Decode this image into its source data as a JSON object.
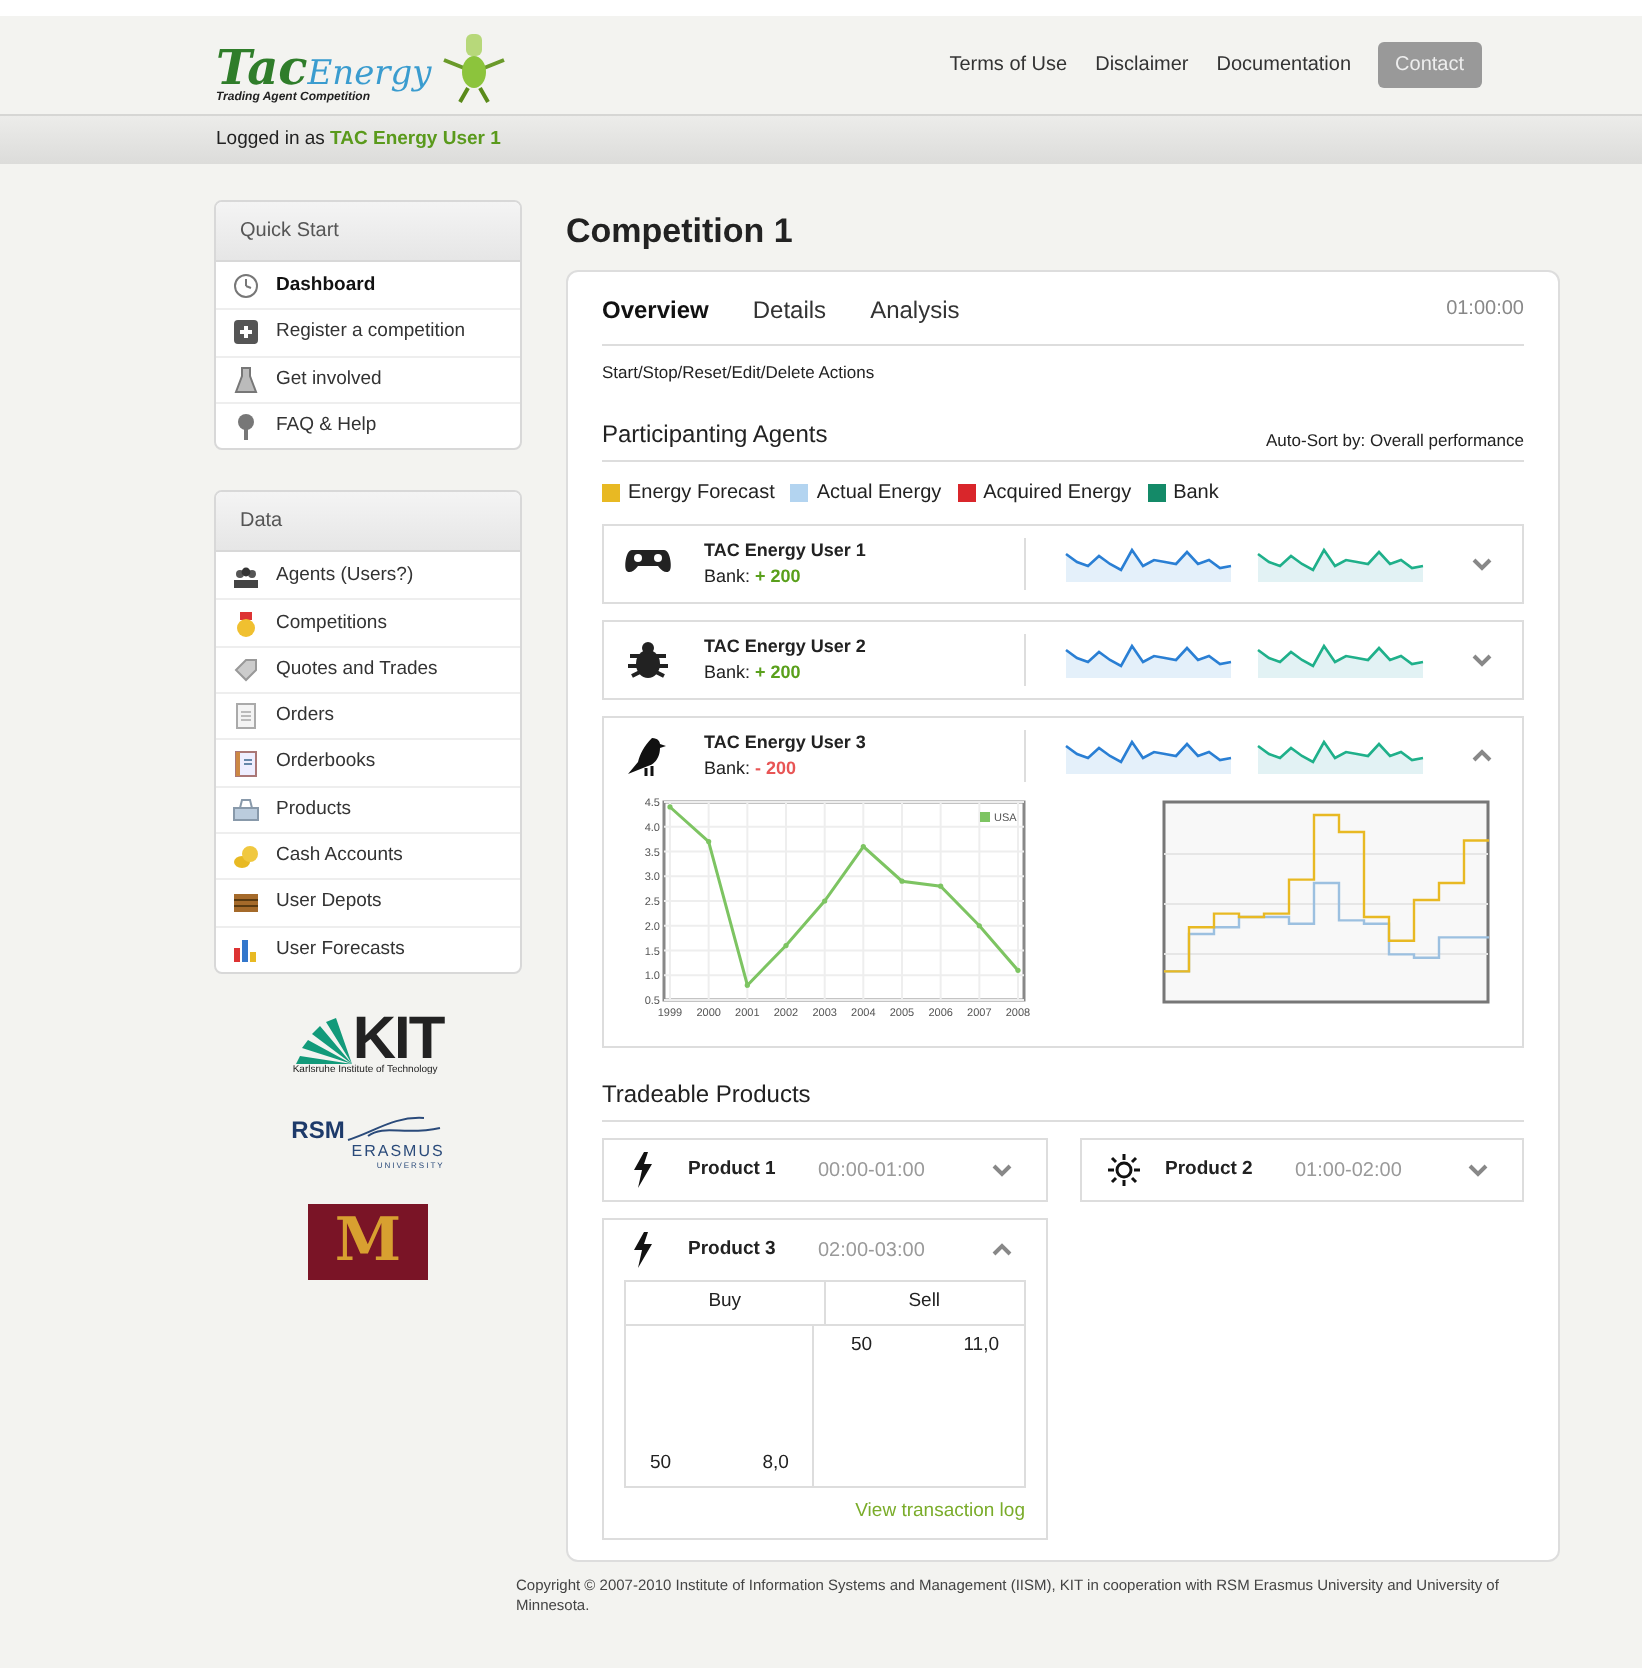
{
  "header": {
    "logo": {
      "part1": "Tac",
      "part2": "Energy",
      "subtitle": "Trading Agent Competition"
    },
    "nav": [
      {
        "label": "Terms of Use",
        "kind": "link"
      },
      {
        "label": "Disclaimer",
        "kind": "link"
      },
      {
        "label": "Documentation",
        "kind": "link"
      },
      {
        "label": "Contact",
        "kind": "button"
      }
    ]
  },
  "login_bar": {
    "prefix": "Logged in as",
    "user": "TAC Energy User 1"
  },
  "sidebar": {
    "panels": [
      {
        "title": "Quick Start",
        "items": [
          {
            "label": "Dashboard",
            "kind": "clock",
            "selected": true
          },
          {
            "label": "Register a competition",
            "kind": "plus",
            "selected": false
          },
          {
            "label": "Get involved",
            "kind": "flask",
            "selected": false
          },
          {
            "label": "FAQ & Help",
            "kind": "pin",
            "selected": false
          }
        ]
      },
      {
        "title": "Data",
        "items": [
          {
            "label": "Agents (Users?)",
            "kind": "people",
            "selected": false
          },
          {
            "label": "Competitions",
            "kind": "medal",
            "selected": false
          },
          {
            "label": "Quotes and Trades",
            "kind": "tag",
            "selected": false
          },
          {
            "label": "Orders",
            "kind": "document",
            "selected": false
          },
          {
            "label": "Orderbooks",
            "kind": "book",
            "selected": false
          },
          {
            "label": "Products",
            "kind": "box",
            "selected": false
          },
          {
            "label": "Cash Accounts",
            "kind": "coins",
            "selected": false
          },
          {
            "label": "User Depots",
            "kind": "chest",
            "selected": false
          },
          {
            "label": "User Forecasts",
            "kind": "bars",
            "selected": false
          }
        ]
      }
    ],
    "partners": [
      {
        "kind": "kit",
        "name": "KIT",
        "caption": "Karlsruhe Institute of Technology"
      },
      {
        "kind": "rsm",
        "name": "RSM",
        "line1": "ERASMUS",
        "line2": "UNIVERSITY"
      },
      {
        "kind": "umn",
        "name": "M"
      }
    ]
  },
  "main": {
    "title": "Competition 1",
    "tabs": [
      {
        "label": "Overview",
        "selected": true
      },
      {
        "label": "Details",
        "selected": false
      },
      {
        "label": "Analysis",
        "selected": false
      }
    ],
    "timer": "01:00:00",
    "actions": "Start/Stop/Reset/Edit/Delete Actions",
    "agents_heading": "Participanting Agents",
    "sort_label": "Auto-Sort by: Overall performance",
    "legend": [
      {
        "label": "Energy Forecast",
        "color": "#e8b923"
      },
      {
        "label": "Actual Energy",
        "color": "#b3d4f0"
      },
      {
        "label": "Acquired Energy",
        "color": "#d9262b"
      },
      {
        "label": "Bank",
        "color": "#148a68"
      }
    ],
    "agents": [
      {
        "name": "TAC Energy User 1",
        "bank_label": "Bank:",
        "bank_value": "+ 200",
        "positive": true,
        "kind": "gamepad",
        "expanded": false
      },
      {
        "name": "TAC Energy User 2",
        "bank_label": "Bank:",
        "bank_value": "+ 200",
        "positive": true,
        "kind": "bug",
        "expanded": false
      },
      {
        "name": "TAC Energy User 3",
        "bank_label": "Bank:",
        "bank_value": "- 200",
        "positive": false,
        "kind": "bird",
        "expanded": true,
        "chart_data": {
          "type": "line",
          "grid": true,
          "x": [
            "1999",
            "2000",
            "2001",
            "2002",
            "2003",
            "2004",
            "2005",
            "2006",
            "2007",
            "2008"
          ],
          "series": [
            {
              "name": "USA",
              "color": "#7dc462",
              "values": [
                4.4,
                3.7,
                0.8,
                1.6,
                2.5,
                3.6,
                2.9,
                2.8,
                2.0,
                1.1
              ]
            }
          ],
          "ylim": [
            0.5,
            4.5
          ],
          "yticks": [
            {
              "value": 0.5,
              "label": "0.5"
            },
            {
              "value": 1,
              "label": "1.0"
            },
            {
              "value": 1.5,
              "label": "1.5"
            },
            {
              "value": 2,
              "label": "2.0"
            },
            {
              "value": 2.5,
              "label": "2.5"
            },
            {
              "value": 3,
              "label": "3.0"
            },
            {
              "value": 3.5,
              "label": "3.5"
            },
            {
              "value": 4,
              "label": "4.0"
            },
            {
              "value": 4.5,
              "label": "4.5"
            }
          ]
        }
      }
    ],
    "products_heading": "Tradeable Products",
    "products": [
      {
        "name": "Product 1",
        "time": "00:00-01:00",
        "kind": "lightning",
        "expanded": false
      },
      {
        "name": "Product 2",
        "time": "01:00-02:00",
        "kind": "sun",
        "expanded": false
      },
      {
        "name": "Product 3",
        "time": "02:00-03:00",
        "kind": "lightning",
        "expanded": true,
        "columns": [
          "Buy",
          "Sell"
        ],
        "buy": [
          [
            "50",
            "8,0"
          ]
        ],
        "sell": [
          [
            "50",
            "11,0"
          ]
        ],
        "link": "View transaction log"
      }
    ]
  },
  "footer": "Copyright © 2007-2010 Institute of Information Systems and Management (IISM), KIT in cooperation with RSM Erasmus University and University of Minnesota."
}
